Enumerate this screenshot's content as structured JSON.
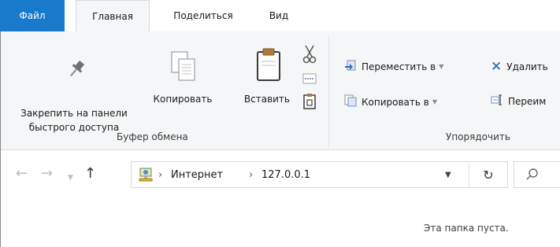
{
  "tabs": {
    "file": "Файл",
    "home": "Главная",
    "share": "Поделиться",
    "view": "Вид"
  },
  "ribbon": {
    "clipboard": {
      "pin_label_1": "Закрепить на панели",
      "pin_label_2": "быстрого доступа",
      "copy_label": "Копировать",
      "paste_label": "Вставить",
      "group_label": "Буфер обмена"
    },
    "organize": {
      "move_to": "Переместить в",
      "copy_to": "Копировать в",
      "delete": "Удалить",
      "rename": "Переим",
      "group_label": "Упорядочить"
    }
  },
  "address": {
    "path": [
      "Интернет",
      "127.0.0.1"
    ]
  },
  "content": {
    "empty_message": "Эта папка пуста."
  },
  "colors": {
    "file_tab": "#1979ca",
    "ribbon_bg": "#f5f6f7"
  }
}
